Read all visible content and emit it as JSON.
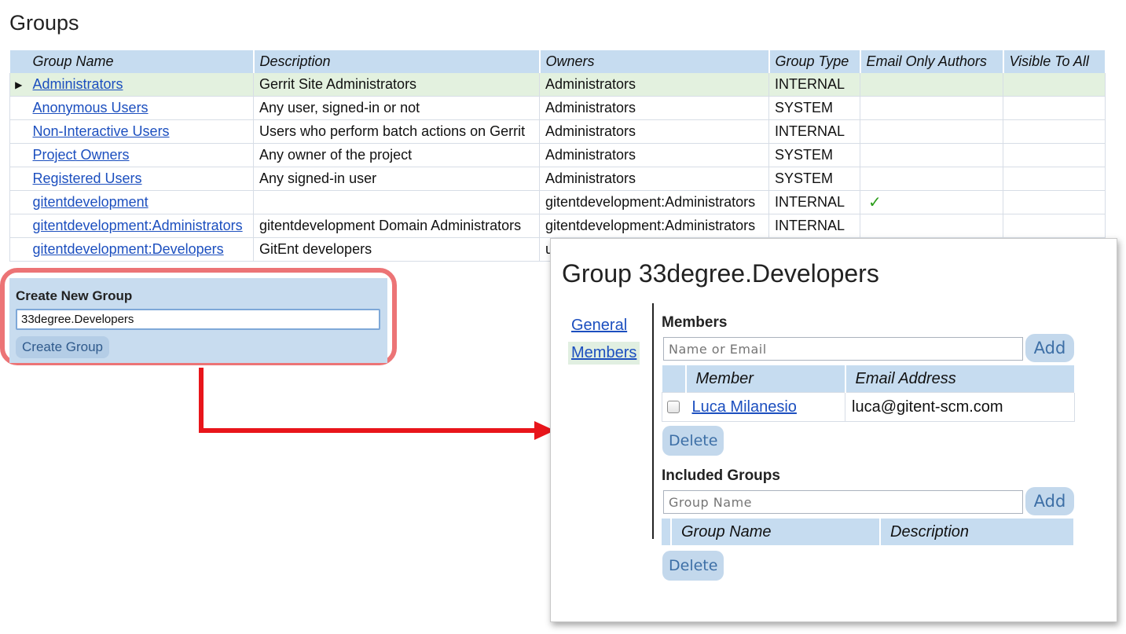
{
  "page": {
    "title": "Groups"
  },
  "groups_table": {
    "columns": [
      "Group Name",
      "Description",
      "Owners",
      "Group Type",
      "Email Only Authors",
      "Visible To All"
    ],
    "rows": [
      {
        "name": "Administrators",
        "description": "Gerrit Site Administrators",
        "owners": "Administrators",
        "type": "INTERNAL",
        "email_only": "",
        "visible": "",
        "selected": true
      },
      {
        "name": "Anonymous Users",
        "description": "Any user, signed-in or not",
        "owners": "Administrators",
        "type": "SYSTEM",
        "email_only": "",
        "visible": ""
      },
      {
        "name": "Non-Interactive Users",
        "description": "Users who perform batch actions on Gerrit",
        "owners": "Administrators",
        "type": "INTERNAL",
        "email_only": "",
        "visible": ""
      },
      {
        "name": "Project Owners",
        "description": "Any owner of the project",
        "owners": "Administrators",
        "type": "SYSTEM",
        "email_only": "",
        "visible": ""
      },
      {
        "name": "Registered Users",
        "description": "Any signed-in user",
        "owners": "Administrators",
        "type": "SYSTEM",
        "email_only": "",
        "visible": ""
      },
      {
        "name": "gitentdevelopment",
        "description": "",
        "owners": "gitentdevelopment:Administrators",
        "type": "INTERNAL",
        "email_only": "✓",
        "visible": ""
      },
      {
        "name": "gitentdevelopment:Administrators",
        "description": "gitentdevelopment Domain Administrators",
        "owners": "gitentdevelopment:Administrators",
        "type": "INTERNAL",
        "email_only": "",
        "visible": ""
      },
      {
        "name": "gitentdevelopment:Developers",
        "description": "GitEnt developers",
        "owners": "u",
        "type": "",
        "email_only": "",
        "visible": ""
      }
    ]
  },
  "create_group": {
    "title": "Create New Group",
    "input_value": "33degree.Developers",
    "button_label": "Create Group"
  },
  "popup": {
    "title": "Group 33degree.Developers",
    "nav": {
      "general": "General",
      "members": "Members"
    },
    "members": {
      "title": "Members",
      "placeholder": "Name or Email",
      "add_label": "Add",
      "columns": [
        "Member",
        "Email Address"
      ],
      "rows": [
        {
          "name": "Luca Milanesio",
          "email": "luca@gitent-scm.com"
        }
      ],
      "delete_label": "Delete"
    },
    "included_groups": {
      "title": "Included Groups",
      "placeholder": "Group Name",
      "add_label": "Add",
      "columns": [
        "Group Name",
        "Description"
      ],
      "delete_label": "Delete"
    }
  },
  "colors": {
    "header_bg": "#c6dcf0",
    "selected_row_bg": "#e3f1df",
    "link": "#1c4fbf",
    "highlight_border": "#ec7476",
    "arrow": "#e8151b",
    "check": "#2c9d1b"
  },
  "icons": {
    "row_pointer": "triangle-right-icon",
    "arrow": "arrow-right-icon",
    "check": "checkmark-icon"
  }
}
